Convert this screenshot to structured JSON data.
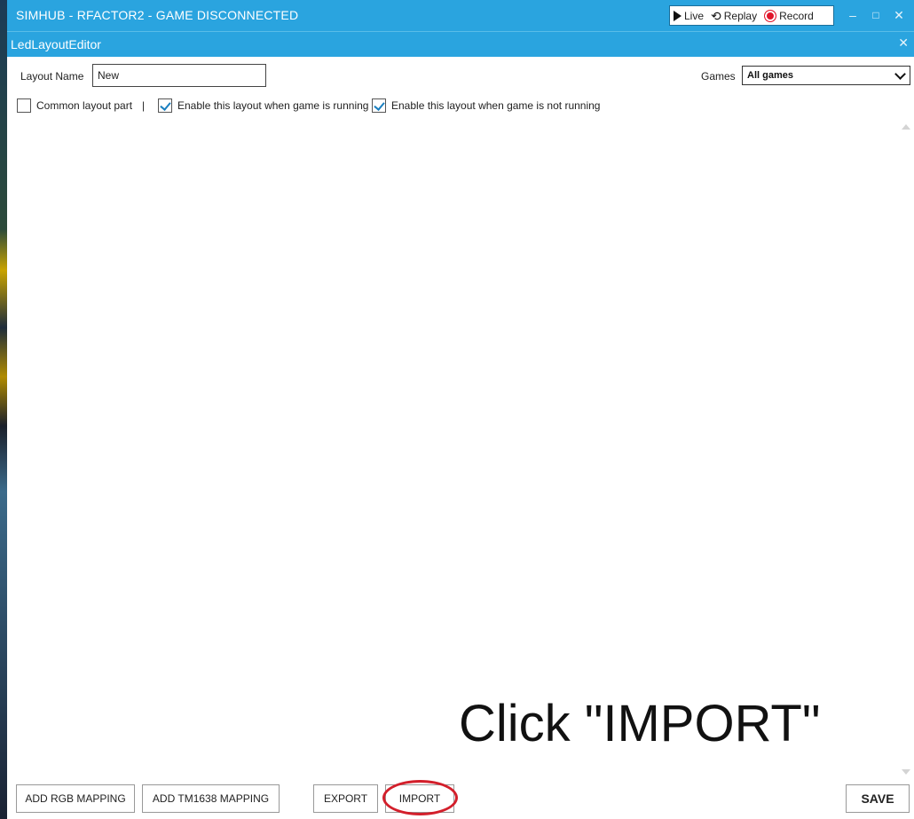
{
  "window": {
    "title": "SIMHUB - RFACTOR2 - GAME DISCONNECTED",
    "toolbar": {
      "live_label": "Live",
      "replay_label": "Replay",
      "record_label": "Record"
    },
    "controls": {
      "minimize": "–",
      "maximize": "□",
      "close": "✕"
    }
  },
  "editor": {
    "title": "LedLayoutEditor",
    "close": "✕",
    "layout_name_label": "Layout Name",
    "layout_name_value": "New",
    "games_label": "Games",
    "games_value": "All games",
    "options": [
      {
        "label": "Common layout part",
        "checked": false
      },
      {
        "label": "Enable this layout when game is running",
        "checked": true
      },
      {
        "label": "Enable this layout when game is not running",
        "checked": true
      }
    ],
    "separator": "|"
  },
  "instruction": "Click \"IMPORT\"",
  "buttons": {
    "add_rgb": "ADD RGB MAPPING",
    "add_tm1638": "ADD TM1638 MAPPING",
    "export": "EXPORT",
    "import": "IMPORT",
    "save": "SAVE"
  },
  "colors": {
    "title_bar": "#2aa4df",
    "checkmark": "#1a7fc0",
    "record": "#e0162b",
    "highlight": "#d31f2b"
  },
  "icons": {
    "live": "play-icon",
    "replay": "replay-icon",
    "record": "record-icon"
  }
}
